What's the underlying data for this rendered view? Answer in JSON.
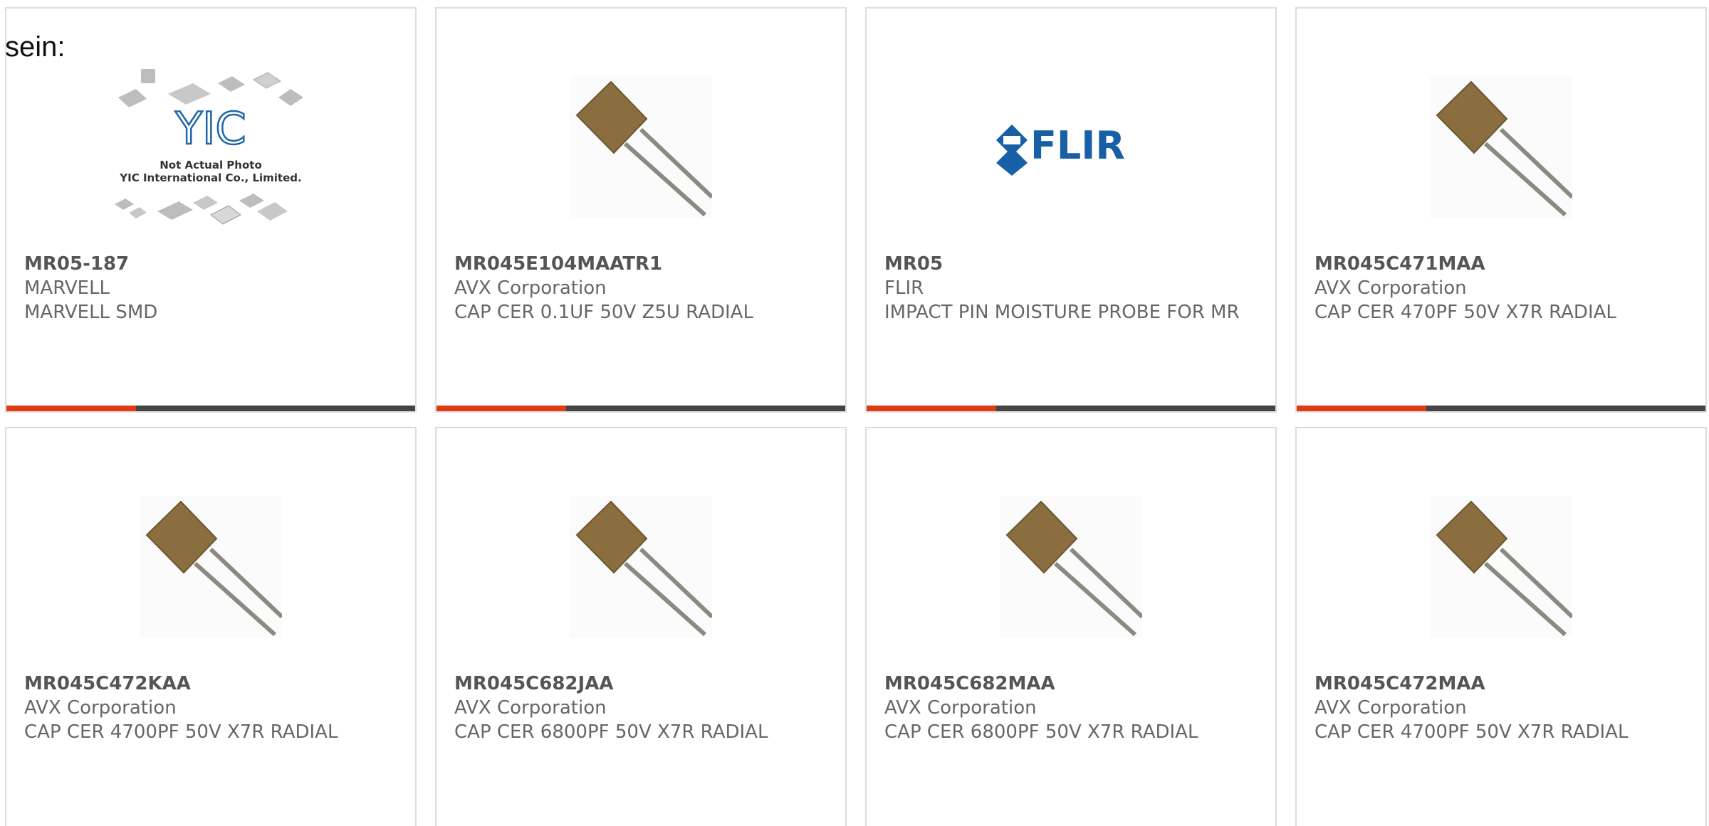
{
  "prefix_text": "sein:",
  "colors": {
    "accent": "#e03c14",
    "bar": "#444444",
    "border": "#dddddd",
    "text": "#666666"
  },
  "products": [
    {
      "part": "MR05-187",
      "maker": "MARVELL",
      "desc": "MARVELL SMD",
      "image": "not-actual-photo",
      "image_text": [
        "Not Actual Photo",
        "YIC International Co., Limited."
      ],
      "logo_text": "YIC"
    },
    {
      "part": "MR045E104MAATR1",
      "maker": "AVX Corporation",
      "desc": "CAP CER 0.1UF 50V Z5U RADIAL",
      "image": "radial-capacitor"
    },
    {
      "part": "MR05",
      "maker": "FLIR",
      "desc": "IMPACT PIN MOISTURE PROBE FOR MR",
      "image": "flir-logo",
      "logo_text": "FLIR"
    },
    {
      "part": "MR045C471MAA",
      "maker": "AVX Corporation",
      "desc": "CAP CER 470PF 50V X7R RADIAL",
      "image": "radial-capacitor"
    },
    {
      "part": "MR045C472KAA",
      "maker": "AVX Corporation",
      "desc": "CAP CER 4700PF 50V X7R RADIAL",
      "image": "radial-capacitor"
    },
    {
      "part": "MR045C682JAA",
      "maker": "AVX Corporation",
      "desc": "CAP CER 6800PF 50V X7R RADIAL",
      "image": "radial-capacitor"
    },
    {
      "part": "MR045C682MAA",
      "maker": "AVX Corporation",
      "desc": "CAP CER 6800PF 50V X7R RADIAL",
      "image": "radial-capacitor"
    },
    {
      "part": "MR045C472MAA",
      "maker": "AVX Corporation",
      "desc": "CAP CER 4700PF 50V X7R RADIAL",
      "image": "radial-capacitor"
    }
  ]
}
